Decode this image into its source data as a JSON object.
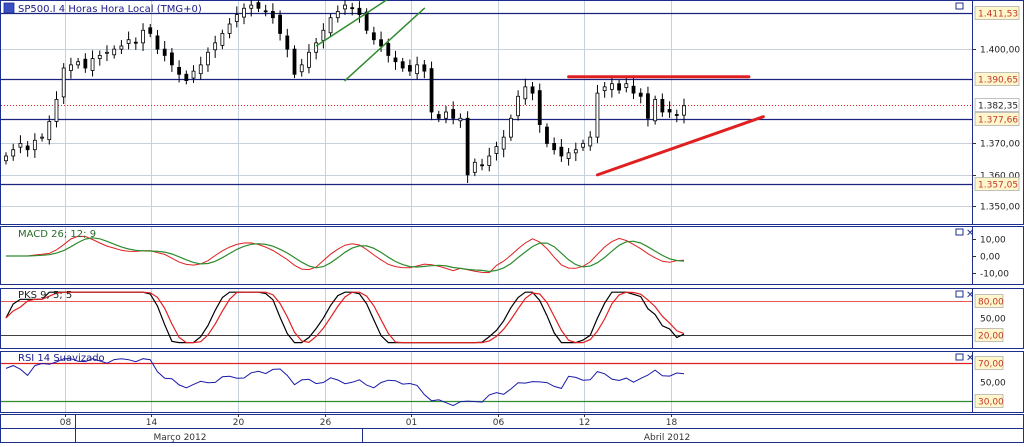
{
  "window": {
    "title": "SP500.I 4 Horas Hora Local (TMG+0)"
  },
  "colors": {
    "grid": "#c8d0dc",
    "panel_border": "#1c2f8c",
    "hline": "#1a237e",
    "red": "#e02020",
    "green": "#2e8b2e",
    "black": "#000000",
    "rsi_line": "#1a1aaa",
    "label_bg": "#fff6cc",
    "price_box_text": "#c0392b"
  },
  "price_panel": {
    "ylim": [
      1345,
      1415
    ],
    "ticks": [
      {
        "value": 1350,
        "label": "1.350,00"
      },
      {
        "value": 1360,
        "label": "1.360,00"
      },
      {
        "value": 1370,
        "label": "1.370,00"
      },
      {
        "value": 1400,
        "label": "1.400,00"
      }
    ],
    "hlines": [
      {
        "value": 1411.53,
        "label": "1.411,53"
      },
      {
        "value": 1390.65,
        "label": "1.390,65"
      },
      {
        "value": 1377.66,
        "label": "1.377,66"
      },
      {
        "value": 1357.05,
        "label": "1.357,05"
      }
    ],
    "current": {
      "value": 1382.35,
      "label": "1.382,35"
    }
  },
  "macd_panel": {
    "title": "MACD 26; 12; 9",
    "ylim": [
      -14,
      14
    ],
    "ticks": [
      {
        "value": 10,
        "label": "10,00"
      },
      {
        "value": 0,
        "label": "0,00"
      },
      {
        "value": -10,
        "label": "-10,00"
      }
    ]
  },
  "stoch_panel": {
    "title": "PKS 9; 5; 5",
    "ylim": [
      0,
      100
    ],
    "ticks": [
      {
        "value": 50,
        "label": "50,00"
      }
    ],
    "levels": [
      {
        "value": 80,
        "label": "80,00"
      },
      {
        "value": 20,
        "label": "20,00"
      }
    ]
  },
  "rsi_panel": {
    "title": "RSI 14 Suavizado",
    "ylim": [
      20,
      80
    ],
    "ticks": [
      {
        "value": 50,
        "label": "50,00"
      }
    ],
    "levels": [
      {
        "value": 70,
        "label": "70,00"
      },
      {
        "value": 30,
        "label": "30,00"
      }
    ]
  },
  "x_axis": {
    "days": [
      "08",
      "14",
      "20",
      "26",
      "01",
      "06",
      "12",
      "18"
    ],
    "months": [
      "Março 2012",
      "Abril 2012"
    ]
  },
  "chart_data": {
    "type": "candlestick",
    "title": "SP500.I 4 Horas Hora Local (TMG+0)",
    "x_unit": "bar index (4-hour bars)",
    "x_ticks": [
      {
        "bar": 4,
        "label": "08"
      },
      {
        "bar": 16,
        "label": "14"
      },
      {
        "bar": 28,
        "label": "20"
      },
      {
        "bar": 40,
        "label": "26"
      },
      {
        "bar": 52,
        "label": "01"
      },
      {
        "bar": 64,
        "label": "06"
      },
      {
        "bar": 76,
        "label": "12"
      },
      {
        "bar": 88,
        "label": "18"
      }
    ],
    "close": [
      1366,
      1368,
      1370,
      1368,
      1371,
      1372,
      1377,
      1384,
      1394,
      1395,
      1396,
      1394,
      1397,
      1398,
      1399,
      1400,
      1401,
      1403,
      1402,
      1406,
      1405,
      1400,
      1398,
      1395,
      1392,
      1390,
      1393,
      1395,
      1399,
      1402,
      1405,
      1408,
      1411,
      1413,
      1414,
      1413,
      1412,
      1410,
      1405,
      1400,
      1392,
      1395,
      1399,
      1402,
      1406,
      1410,
      1412,
      1414,
      1413,
      1411,
      1406,
      1403,
      1401,
      1398,
      1396,
      1394,
      1393,
      1395,
      1393,
      1380,
      1378,
      1380,
      1378,
      1378,
      1360,
      1364,
      1363,
      1366,
      1369,
      1372,
      1378,
      1385,
      1388,
      1386,
      1376,
      1370,
      1368,
      1366,
      1367,
      1368,
      1370,
      1372,
      1386,
      1388,
      1389,
      1387,
      1389,
      1386,
      1385,
      1378,
      1384,
      1380,
      1380,
      1379,
      1382
    ],
    "trendlines": [
      {
        "color": "red",
        "from": [
          78,
          1391.2
        ],
        "to": [
          103,
          1391.2
        ]
      },
      {
        "color": "red",
        "from": [
          82,
          1360
        ],
        "to": [
          105,
          1378.5
        ]
      },
      {
        "color": "green",
        "from": [
          47,
          1390
        ],
        "to": [
          58,
          1413
        ]
      }
    ],
    "horizontal_levels": [
      1411.53,
      1390.65,
      1377.66,
      1357.05
    ],
    "current_price": 1382.35,
    "indicators": {
      "macd": {
        "fast": 26,
        "slow": 12,
        "signal": 9,
        "ylim": [
          -14,
          14
        ]
      },
      "stochastic": {
        "params": "9; 5; 5",
        "overbought": 80,
        "oversold": 20
      },
      "rsi": {
        "period": 14,
        "overbought": 70,
        "oversold": 30
      }
    }
  }
}
